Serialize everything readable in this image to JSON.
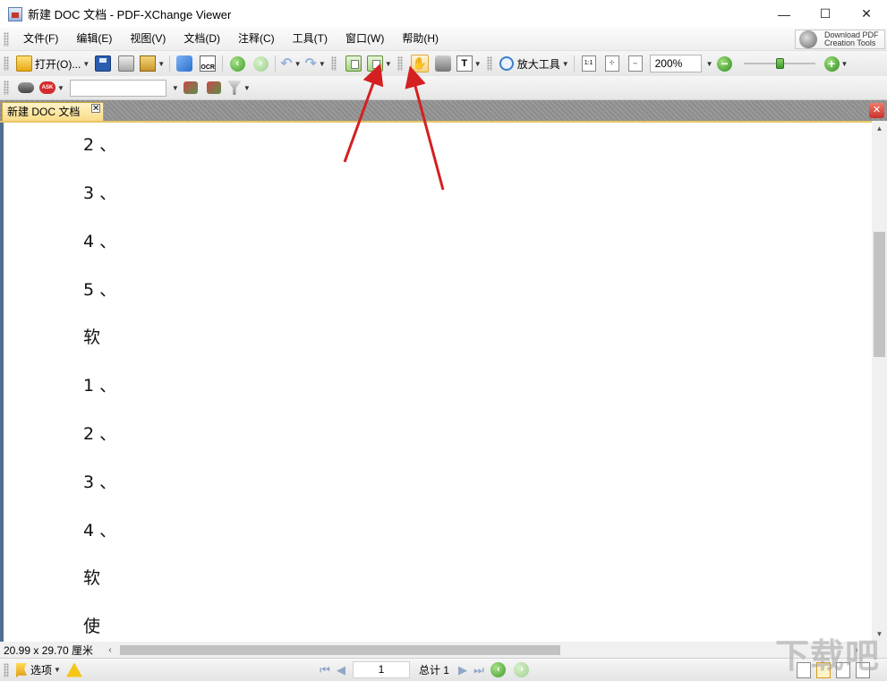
{
  "window": {
    "title": "新建 DOC 文档 - PDF-XChange Viewer",
    "minimize_glyph": "—",
    "maximize_glyph": "☐",
    "close_glyph": "✕"
  },
  "menu": {
    "items": [
      "文件(F)",
      "编辑(E)",
      "视图(V)",
      "文档(D)",
      "注释(C)",
      "工具(T)",
      "窗口(W)",
      "帮助(H)"
    ],
    "download_line1": "Download PDF",
    "download_line2": "Creation Tools"
  },
  "toolbar": {
    "open_label": "打开(O)...",
    "ocr_label": "OCR",
    "zoom_tool_label": "放大工具",
    "actual_size_label": "1:1",
    "zoom_value": "200%",
    "zoom_level": 0.45
  },
  "toolbar2": {
    "ask_label": "ASK",
    "search_value": ""
  },
  "tabs": {
    "doc_tab_label": "新建 DOC 文档",
    "tab_close_glyph": "✕",
    "strip_close_glyph": "✕"
  },
  "document": {
    "lines": [
      "2 、",
      "3 、",
      "4 、",
      "5 、",
      "软",
      "1 、",
      "2 、",
      "3 、",
      "4 、",
      "软",
      "使"
    ]
  },
  "status": {
    "page_size": "20.99 x 29.70 厘米",
    "options_label": "选项",
    "current_page": "1",
    "total_pages": "总计 1"
  },
  "watermark": "下载吧",
  "colors": {
    "annotation_arrow": "#d42020",
    "tab_accent": "#f9dc86"
  }
}
